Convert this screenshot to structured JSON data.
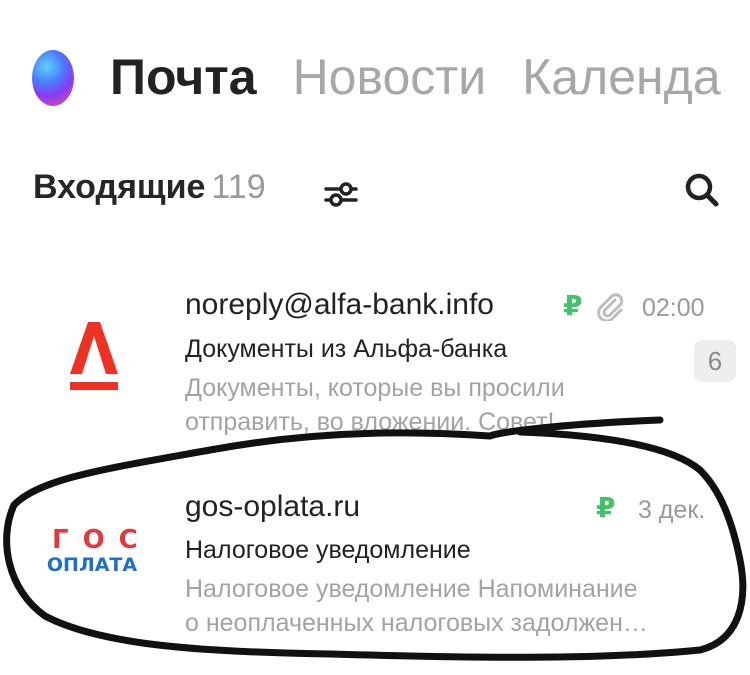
{
  "header": {
    "tabs": [
      {
        "label": "Почта",
        "active": true
      },
      {
        "label": "Новости",
        "active": false
      },
      {
        "label": "Календа",
        "active": false
      }
    ]
  },
  "inbox": {
    "title": "Входящие",
    "count": "119"
  },
  "emails": [
    {
      "avatar": "alfa-bank-logo",
      "sender": "noreply@alfa-bank.info",
      "time": "02:00",
      "subject": "Документы из Альфа-банка",
      "snippet_line1": "Документы, которые вы просили",
      "snippet_line2": "отправить, во вложении. Совет!",
      "thread_count": "6",
      "ruble": "₽",
      "has_attachment": true
    },
    {
      "avatar": "gos-oplata-logo",
      "avatar_text_top": "ГОС",
      "avatar_text_bottom": "ОПЛАТА",
      "sender": "gos-oplata.ru",
      "time": "3 дек.",
      "subject": "Налоговое уведомление",
      "snippet_line1": "Налоговое уведомление Напоминание",
      "snippet_line2": "о неоплаченных налоговых задолжен…",
      "ruble": "₽",
      "has_attachment": false
    }
  ],
  "colors": {
    "alfa_red": "#ef3124",
    "gos_red": "#e03a3e",
    "gos_blue": "#1d6fce",
    "ruble_green": "#43c26b"
  }
}
